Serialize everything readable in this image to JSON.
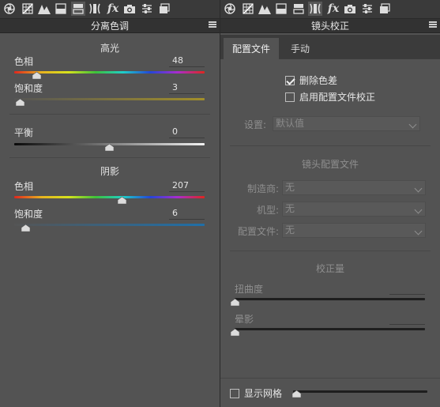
{
  "left_panel": {
    "title": "分离色调",
    "highlights": {
      "heading": "高光",
      "hue": {
        "label": "色相",
        "value": "48",
        "fraction": 0.119
      },
      "saturation": {
        "label": "饱和度",
        "value": "3",
        "fraction": 0.03
      }
    },
    "balance": {
      "label": "平衡",
      "value": "0",
      "fraction": 0.5
    },
    "shadows": {
      "heading": "阴影",
      "hue": {
        "label": "色相",
        "value": "207",
        "fraction": 0.567
      },
      "saturation": {
        "label": "饱和度",
        "value": "6",
        "fraction": 0.06
      }
    }
  },
  "right_panel": {
    "title": "镜头校正",
    "tabs": [
      {
        "label": "配置文件",
        "active": true
      },
      {
        "label": "手动",
        "active": false
      }
    ],
    "remove_ca": {
      "label": "删除色差",
      "checked": true
    },
    "enable_profile": {
      "label": "启用配置文件校正",
      "checked": false
    },
    "setup": {
      "label": "设置:",
      "value": "默认值"
    },
    "lens_profile": {
      "heading": "镜头配置文件",
      "make": {
        "label": "制造商:",
        "value": "无"
      },
      "model": {
        "label": "机型:",
        "value": "无"
      },
      "profile": {
        "label": "配置文件:",
        "value": "无"
      }
    },
    "amount": {
      "heading": "校正量",
      "distortion": {
        "label": "扭曲度",
        "fraction": 0.0
      },
      "vignetting": {
        "label": "晕影",
        "fraction": 0.0
      }
    },
    "show_grid": {
      "label": "显示网格",
      "checked": false,
      "fraction": 0.0
    }
  },
  "toolbar_icons": [
    "basic-aperture-icon",
    "tone-curve-icon",
    "hsl-mountains-icon",
    "split-toning-icon",
    "detail-icon",
    "lens-corrections-icon",
    "effects-fx-icon",
    "camera-calibration-icon",
    "presets-sliders-icon",
    "snapshots-icon"
  ],
  "colors": {
    "panel_bg": "#535353",
    "toolbar_bg": "#3a3a3a",
    "title_bg": "#323232",
    "text": "#e4e4e4",
    "dim_text": "#8e8e8e"
  }
}
